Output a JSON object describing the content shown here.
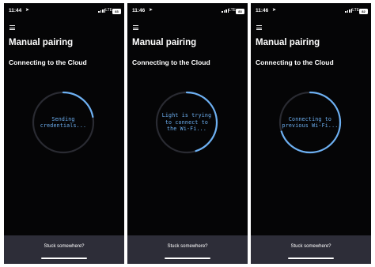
{
  "screens": [
    {
      "status_bar": {
        "time": "11:44",
        "network": "LTE",
        "battery": "83"
      },
      "title": "Manual pairing",
      "subtitle": "Connecting to the Cloud",
      "progress": {
        "status": "Sending\ncredentials...",
        "fraction": 0.22
      },
      "footer": {
        "help_text": "Stuck somewhere?"
      }
    },
    {
      "status_bar": {
        "time": "11:46",
        "network": "LTE",
        "battery": "83"
      },
      "title": "Manual pairing",
      "subtitle": "Connecting to the Cloud",
      "progress": {
        "status": "Light is trying\nto connect to\nthe Wi-Fi...",
        "fraction": 0.45
      },
      "footer": {
        "help_text": "Stuck somewhere?"
      }
    },
    {
      "status_bar": {
        "time": "11:46",
        "network": "LTE",
        "battery": "82"
      },
      "title": "Manual pairing",
      "subtitle": "Connecting to the Cloud",
      "progress": {
        "status": "Connecting to\nprevious Wi-Fi...",
        "fraction": 0.7
      },
      "footer": {
        "help_text": "Stuck somewhere?"
      }
    }
  ],
  "colors": {
    "background": "#050506",
    "progress_track": "#2a2b32",
    "progress_fill": "#6db0f2",
    "footer": "#2d2d38"
  },
  "icons": {
    "menu": "hamburger-icon",
    "location": "location-arrow-icon",
    "signal": "signal-bars-icon",
    "battery": "battery-icon"
  }
}
